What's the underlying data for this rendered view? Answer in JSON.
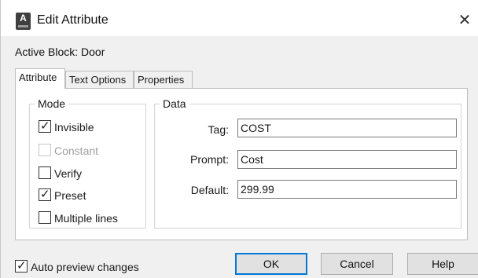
{
  "window": {
    "title": "Edit Attribute",
    "close_glyph": "✕",
    "icon": "autocad-app-icon"
  },
  "active_block": "Active Block: Door",
  "tabs": [
    {
      "label": "Attribute",
      "active": true
    },
    {
      "label": "Text Options",
      "active": false
    },
    {
      "label": "Properties",
      "active": false
    }
  ],
  "mode": {
    "title": "Mode",
    "options": [
      {
        "label": "Invisible",
        "checked": true,
        "enabled": true
      },
      {
        "label": "Constant",
        "checked": false,
        "enabled": false
      },
      {
        "label": "Verify",
        "checked": false,
        "enabled": true
      },
      {
        "label": "Preset",
        "checked": true,
        "enabled": true
      },
      {
        "label": "Multiple lines",
        "checked": false,
        "enabled": true
      }
    ]
  },
  "data": {
    "title": "Data",
    "tag_label": "Tag:",
    "tag_value": "COST",
    "prompt_label": "Prompt:",
    "prompt_value": "Cost",
    "default_label": "Default:",
    "default_value": "299.99"
  },
  "footer": {
    "auto_preview_label": "Auto preview changes",
    "auto_preview_checked": true,
    "ok_label": "OK",
    "cancel_label": "Cancel",
    "help_label": "Help"
  },
  "check_glyph": "✓",
  "colors": {
    "focus_border": "#0078d7",
    "disabled_text": "#a0a0a0"
  }
}
